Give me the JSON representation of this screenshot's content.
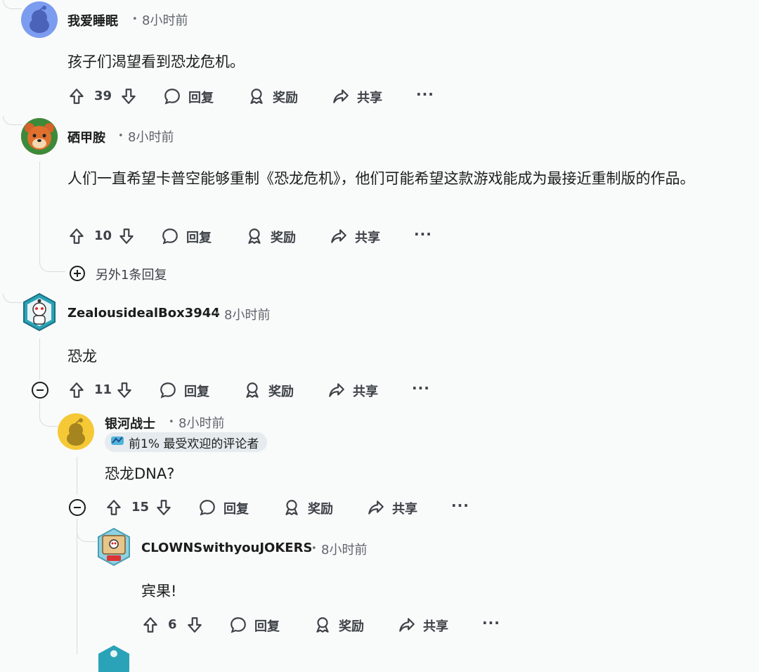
{
  "comments": [
    {
      "username": "我爱睡眠",
      "time": "8小时前",
      "text": "孩子们渴望看到恐龙危机。",
      "votes": "39"
    },
    {
      "username": "硒甲胺",
      "time": "8小时前",
      "text": "人们一直希望卡普空能够重制《恐龙危机》，他们可能希望这款游戏能成为最接近重制版的作品。",
      "votes": "10",
      "more_replies": "另外1条回复"
    },
    {
      "username": "ZealousidealBox3944",
      "time": "8小时前",
      "text": "恐龙",
      "votes": "11"
    },
    {
      "username": "银河战士",
      "time": "8小时前",
      "badge": "前1% 最受欢迎的评论者",
      "text": "恐龙DNA?",
      "votes": "15"
    },
    {
      "username": "CLOWNSwithyouJOKERS",
      "time": "8小时前",
      "text": "宾果!",
      "votes": "6"
    }
  ],
  "actions": {
    "reply": "回复",
    "award": "奖励",
    "share": "共享",
    "more": "···"
  },
  "separator": "•",
  "colors": {
    "background": "#f9fafa",
    "thread_line": "#d9dadb",
    "text": "#1c1c1c",
    "meta": "#5f656b"
  }
}
